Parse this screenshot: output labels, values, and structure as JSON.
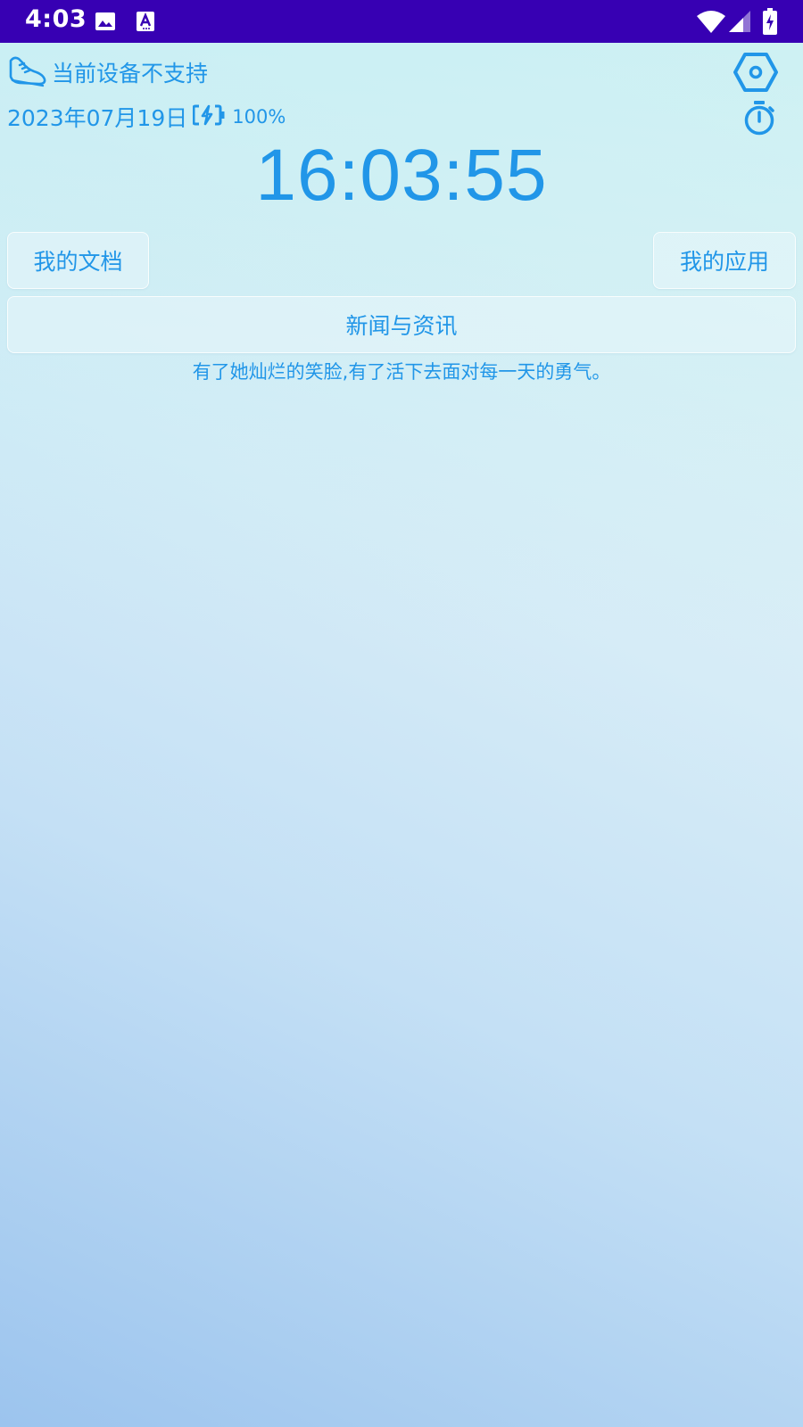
{
  "status_bar": {
    "time": "4:03",
    "icons": [
      "image-icon",
      "text-a-icon",
      "wifi-icon",
      "signal-icon",
      "battery-charging-icon"
    ],
    "background": "#3700b3"
  },
  "step": {
    "icon": "shoe-icon",
    "label": "当前设备不支持"
  },
  "date_row": {
    "date": "2023年07月19日",
    "battery_icon": "battery-charging-icon",
    "battery_percent": "100%"
  },
  "clock": {
    "time": "16:03:55"
  },
  "buttons": {
    "docs": "我的文档",
    "apps": "我的应用",
    "news": "新闻与资讯"
  },
  "quote": "有了她灿烂的笑脸,有了活下去面对每一天的勇气。",
  "colors": {
    "accent": "#2196e8",
    "status_bar": "#3700b3"
  }
}
